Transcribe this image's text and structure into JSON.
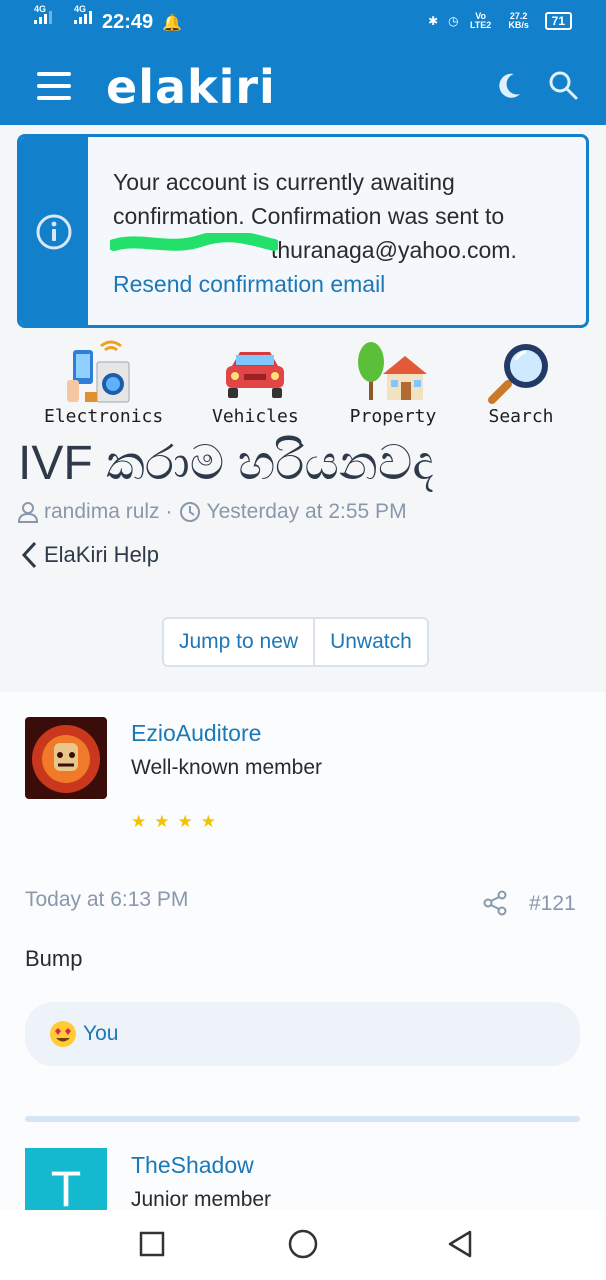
{
  "status_bar": {
    "net1": "4G",
    "net2": "4G",
    "time": "22:49",
    "volte": "Vo LTE2",
    "speed": "27.2 KB/s",
    "battery": "71"
  },
  "header": {
    "logo_text": "elakiri",
    "brand_color": "#1380cc"
  },
  "notice": {
    "text_line1": "Your account is currently awaiting confirmation. Confirmation was sent to",
    "email_visible": "thuranaga@yahoo.com.",
    "resend_link": "Resend confirmation email"
  },
  "categories": [
    {
      "label": "Electronics",
      "icon": "electronics-icon"
    },
    {
      "label": "Vehicles",
      "icon": "car-icon"
    },
    {
      "label": "Property",
      "icon": "house-icon"
    },
    {
      "label": "Search",
      "icon": "magnifier-icon"
    }
  ],
  "thread": {
    "title": "IVF කරාම හරියනවද",
    "author": "randima rulz",
    "separator": "·",
    "posted": "Yesterday at 2:55 PM",
    "breadcrumb": "ElaKiri Help",
    "jump_label": "Jump to new",
    "unwatch_label": "Unwatch"
  },
  "posts": [
    {
      "username": "EzioAuditore",
      "user_title": "Well-known member",
      "stars": 4,
      "date": "Today at 6:13 PM",
      "number": "#121",
      "body": "Bump",
      "reaction_label": "You"
    },
    {
      "username": "TheShadow",
      "user_title": "Junior member",
      "avatar_letter": "T"
    }
  ]
}
